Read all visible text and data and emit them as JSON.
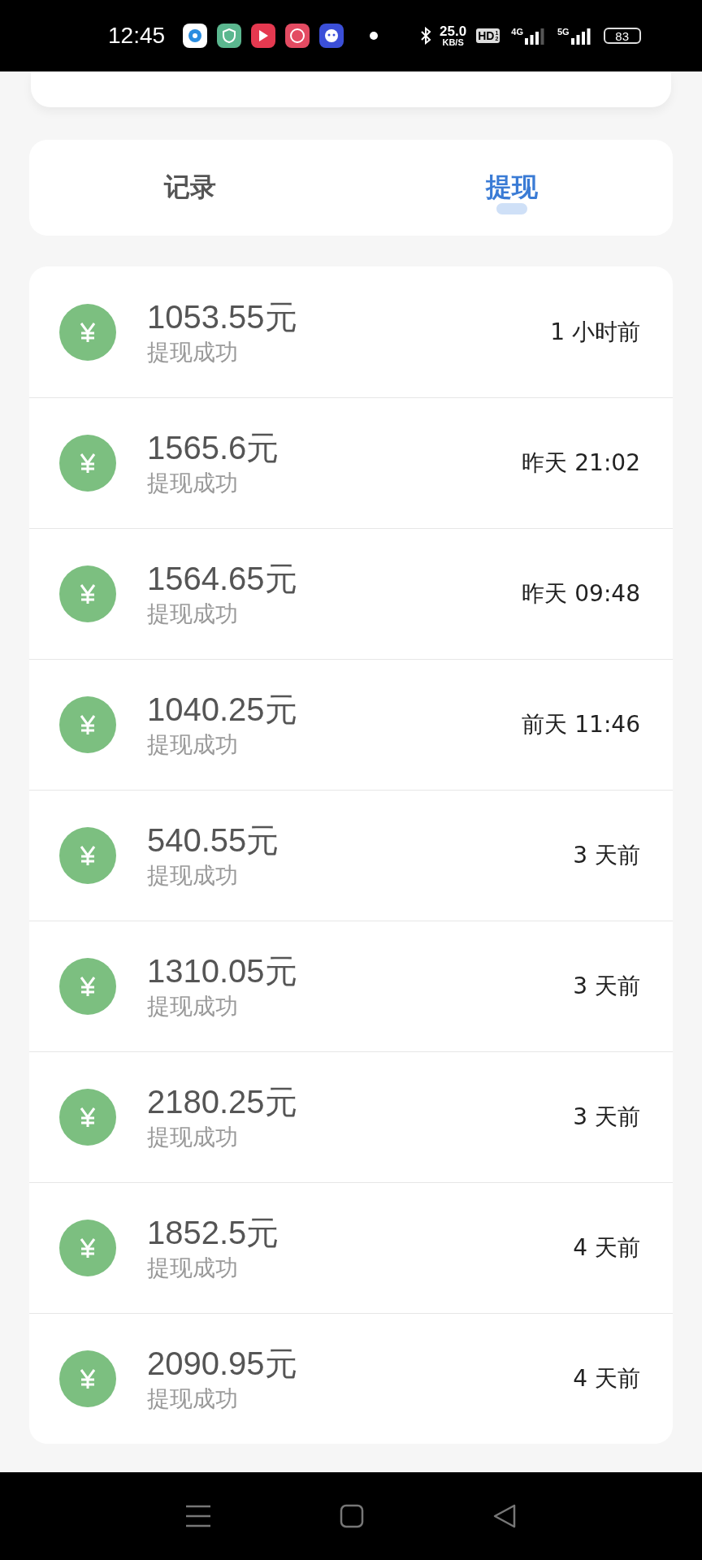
{
  "status_bar": {
    "time": "12:45",
    "speed": "25.0",
    "speed_unit": "KB/S",
    "hd": "HD",
    "hd_index": [
      "1",
      "2"
    ],
    "network_1": "4G",
    "network_2": "5G",
    "battery": "83"
  },
  "tabs": [
    {
      "label": "记录",
      "selected": false
    },
    {
      "label": "提现",
      "selected": true
    }
  ],
  "records": [
    {
      "amount": "1053.55元",
      "status": "提现成功",
      "time": "1 小时前"
    },
    {
      "amount": "1565.6元",
      "status": "提现成功",
      "time": "昨天 21:02"
    },
    {
      "amount": "1564.65元",
      "status": "提现成功",
      "time": "昨天 09:48"
    },
    {
      "amount": "1040.25元",
      "status": "提现成功",
      "time": "前天 11:46"
    },
    {
      "amount": "540.55元",
      "status": "提现成功",
      "time": "3 天前"
    },
    {
      "amount": "1310.05元",
      "status": "提现成功",
      "time": "3 天前"
    },
    {
      "amount": "2180.25元",
      "status": "提现成功",
      "time": "3 天前"
    },
    {
      "amount": "1852.5元",
      "status": "提现成功",
      "time": "4 天前"
    },
    {
      "amount": "2090.95元",
      "status": "提现成功",
      "time": "4 天前"
    }
  ]
}
